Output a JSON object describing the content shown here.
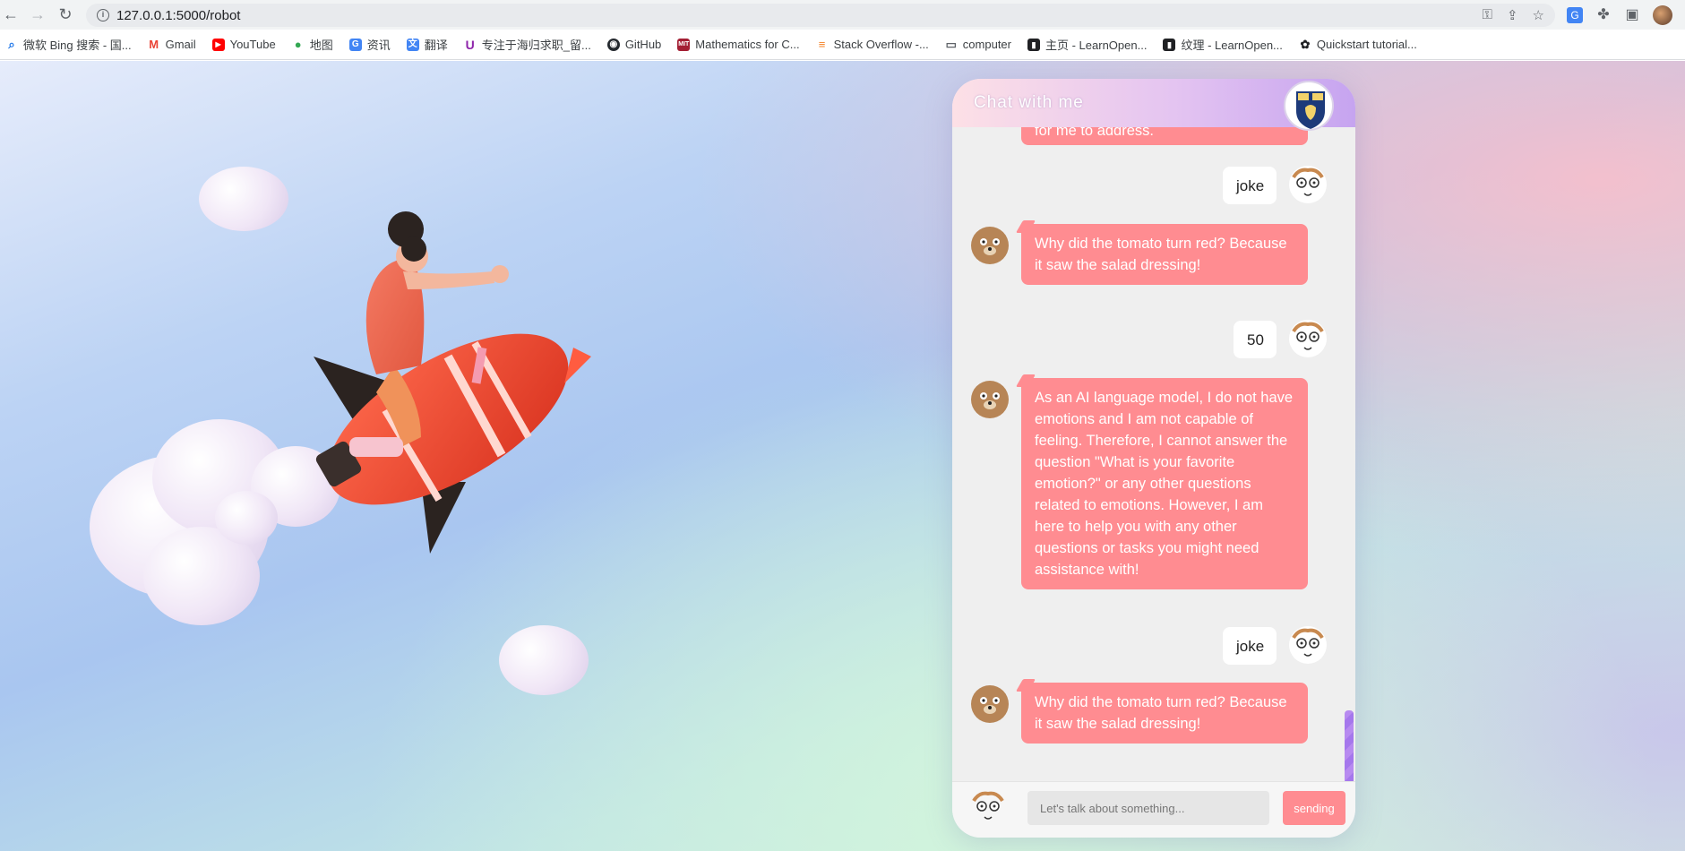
{
  "browser": {
    "url": "127.0.0.1:5000/robot",
    "bookmarks": [
      {
        "label": "微软 Bing 搜索 - 国...",
        "icon": "bing-search-icon",
        "color": "#1a73e8"
      },
      {
        "label": "Gmail",
        "icon": "gmail-icon",
        "color": "#ea4335"
      },
      {
        "label": "YouTube",
        "icon": "youtube-icon",
        "color": "#ff0000"
      },
      {
        "label": "地图",
        "icon": "maps-pin-icon",
        "color": "#34a853"
      },
      {
        "label": "资讯",
        "icon": "news-icon",
        "color": "#4285f4"
      },
      {
        "label": "翻译",
        "icon": "translate-icon",
        "color": "#4285f4"
      },
      {
        "label": "专注于海归求职_留...",
        "icon": "u-logo-icon",
        "color": "#8e24aa"
      },
      {
        "label": "GitHub",
        "icon": "github-icon",
        "color": "#24292e"
      },
      {
        "label": "Mathematics for C...",
        "icon": "mit-ocw-icon",
        "color": "#a31f34"
      },
      {
        "label": "Stack Overflow -...",
        "icon": "stack-overflow-icon",
        "color": "#f48024"
      },
      {
        "label": "computer",
        "icon": "folder-icon",
        "color": "#5f6368"
      },
      {
        "label": "主页 - LearnOpen...",
        "icon": "book-icon",
        "color": "#202124"
      },
      {
        "label": "纹理 - LearnOpen...",
        "icon": "book-icon",
        "color": "#202124"
      },
      {
        "label": "Quickstart tutorial...",
        "icon": "openai-icon",
        "color": "#202124"
      }
    ]
  },
  "chat": {
    "title": "Chat with me",
    "partial_top_text": "for me to address.",
    "messages": [
      {
        "role": "user",
        "text": "joke"
      },
      {
        "role": "bot",
        "text": "Why did the tomato turn red? Because it saw the salad dressing!"
      },
      {
        "role": "user",
        "text": "50"
      },
      {
        "role": "bot",
        "text": "As an AI language model, I do not have emotions and I am not capable of feeling. Therefore, I cannot answer the question \"What is your favorite emotion?\" or any other questions related to emotions. However, I am here to help you with any other questions or tasks you might need assistance with!"
      },
      {
        "role": "user",
        "text": "joke"
      },
      {
        "role": "bot",
        "text": "Why did the tomato turn red? Because it saw the salad dressing!"
      }
    ],
    "input_placeholder": "Let's talk about something...",
    "send_label": "sending",
    "colors": {
      "bot_bubble": "#ff8c91",
      "user_bubble": "#ffffff",
      "accent": "#b78af0"
    }
  }
}
